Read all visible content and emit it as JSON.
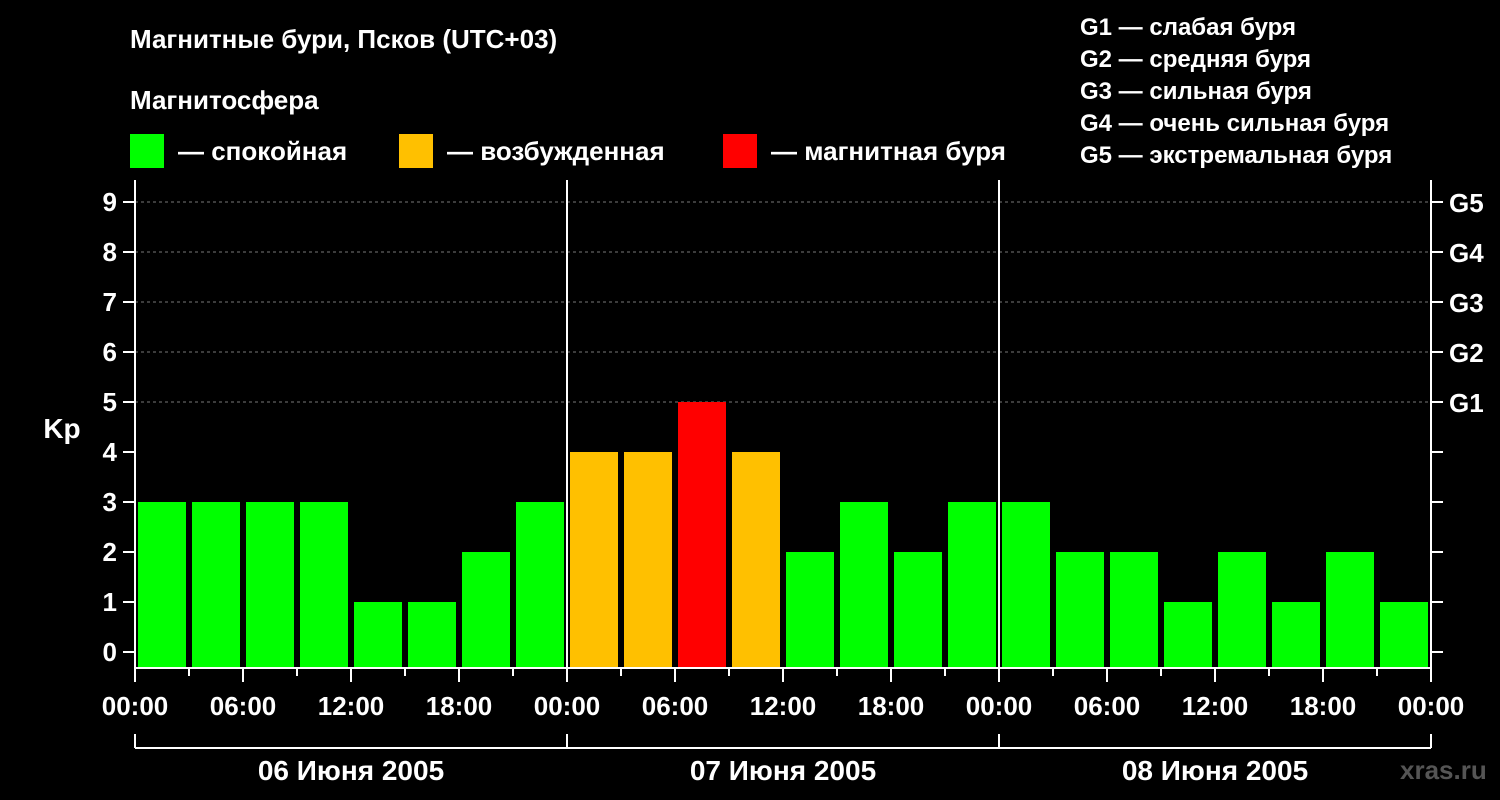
{
  "title": "Магнитные бури, Псков (UTC+03)",
  "subtitle": "Магнитосфера",
  "legend": [
    {
      "label": "— спокойная",
      "color": "#00ff00"
    },
    {
      "label": "— возбужденная",
      "color": "#ffc000"
    },
    {
      "label": "— магнитная буря",
      "color": "#ff0000"
    }
  ],
  "g_scale": [
    {
      "label": "G1 — слабая буря"
    },
    {
      "label": "G2 — средняя буря"
    },
    {
      "label": "G3 — сильная буря"
    },
    {
      "label": "G4 — очень сильная буря"
    },
    {
      "label": "G5 — экстремальная буря"
    }
  ],
  "watermark": "xras.ru",
  "colors": {
    "background": "#000000",
    "quiet": "#00ff00",
    "active": "#ffc000",
    "storm": "#ff0000",
    "grid": "#777777",
    "axis": "#ffffff"
  },
  "chart_data": {
    "type": "bar",
    "ylabel": "Kp",
    "ylim": [
      0,
      9
    ],
    "yticks": [
      "0",
      "1",
      "2",
      "3",
      "4",
      "5",
      "6",
      "7",
      "8",
      "9"
    ],
    "gridlines": [
      5,
      6,
      7,
      8,
      9
    ],
    "right_axis_labels": [
      {
        "kp": 5,
        "label": "G1"
      },
      {
        "kp": 6,
        "label": "G2"
      },
      {
        "kp": 7,
        "label": "G3"
      },
      {
        "kp": 8,
        "label": "G4"
      },
      {
        "kp": 9,
        "label": "G5"
      }
    ],
    "xtick_labels": [
      "00:00",
      "06:00",
      "12:00",
      "18:00",
      "00:00",
      "06:00",
      "12:00",
      "18:00",
      "00:00",
      "06:00",
      "12:00",
      "18:00",
      "00:00"
    ],
    "days": [
      "06 Июня 2005",
      "07 Июня 2005",
      "08 Июня 2005"
    ],
    "interval_hours": 3,
    "values": [
      3,
      3,
      3,
      3,
      1,
      1,
      2,
      3,
      4,
      4,
      5,
      4,
      2,
      3,
      2,
      3,
      3,
      2,
      2,
      1,
      2,
      1,
      2,
      1
    ],
    "levels": [
      "quiet",
      "quiet",
      "quiet",
      "quiet",
      "quiet",
      "quiet",
      "quiet",
      "quiet",
      "active",
      "active",
      "storm",
      "active",
      "quiet",
      "quiet",
      "quiet",
      "quiet",
      "quiet",
      "quiet",
      "quiet",
      "quiet",
      "quiet",
      "quiet",
      "quiet",
      "quiet"
    ]
  }
}
